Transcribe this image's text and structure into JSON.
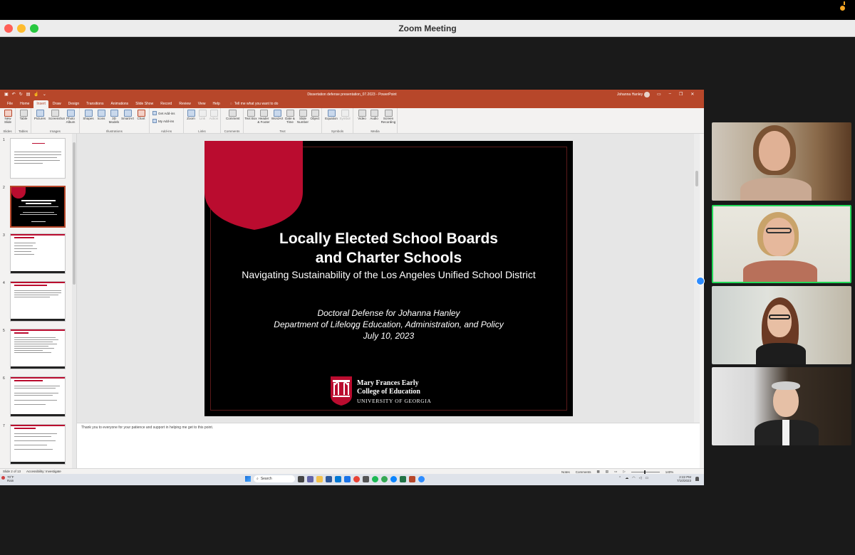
{
  "zoom": {
    "window_title": "Zoom Meeting"
  },
  "ppt": {
    "doc_title": "Dissertation defense presentation_07.2023  -  PowerPoint",
    "user": "Johanna Hanley",
    "tabs": [
      "File",
      "Home",
      "Insert",
      "Draw",
      "Design",
      "Transitions",
      "Animations",
      "Slide Show",
      "Record",
      "Review",
      "View",
      "Help"
    ],
    "active_tab": "Insert",
    "tell_me": "Tell me what you want to do",
    "ribbon": {
      "slides": {
        "new_slide": "New Slide",
        "label": "Slides"
      },
      "tables": {
        "table": "Table",
        "label": "Tables"
      },
      "images": {
        "pictures": "Pictures",
        "screenshot": "Screenshot",
        "photo_album": "Photo Album",
        "label": "Images"
      },
      "illustrations": {
        "shapes": "Shapes",
        "icons": "Icons",
        "models": "3D Models",
        "smartart": "SmartArt",
        "chart": "Chart",
        "label": "Illustrations"
      },
      "addins": {
        "get": "Get Add-ins",
        "my": "My Add-ins",
        "label": "Add-ins"
      },
      "links": {
        "zoom": "Zoom",
        "link": "Link",
        "action": "Action",
        "label": "Links"
      },
      "comments": {
        "comment": "Comment",
        "label": "Comments"
      },
      "text": {
        "textbox": "Text Box",
        "header": "Header & Footer",
        "wordart": "WordArt",
        "datetime": "Date & Time",
        "slidenum": "Slide Number",
        "object": "Object",
        "label": "Text"
      },
      "symbols": {
        "equation": "Equation",
        "symbol": "Symbol",
        "label": "Symbols"
      },
      "media": {
        "video": "Video",
        "audio": "Audio",
        "screen": "Screen Recording",
        "label": "Media"
      }
    },
    "thumb_numbers": [
      "1",
      "2",
      "3",
      "4",
      "5",
      "6",
      "7"
    ],
    "slide": {
      "title_line1": "Locally Elected School Boards",
      "title_line2": "and Charter Schools",
      "subtitle": "Navigating Sustainability of the Los Angeles Unified School District",
      "defense_line": "Doctoral Defense for Johanna Hanley",
      "department": "Department of Lifelong Education, Administration, and Policy",
      "date": "July 10, 2023",
      "logo_line1": "Mary Frances Early",
      "logo_line2": "College of Education",
      "logo_line3": "UNIVERSITY OF GEORGIA"
    },
    "notes": "Thank you to everyone for your patience and support in helping me get to this point.",
    "status": {
      "slide_of": "Slide 2 of 13",
      "accessibility": "Accessibility: Investigate",
      "notes": "Notes",
      "comments": "Comments",
      "zoom": "140%"
    }
  },
  "taskbar": {
    "weather_temp": "70°F",
    "weather_desc": "Rain",
    "search": "Search",
    "time": "2:22 PM",
    "date": "7/10/2023"
  },
  "colors": {
    "ppt_red": "#b7472a",
    "uga_red": "#ba0c2f",
    "speaker_border": "#23d959",
    "zoom_blue": "#2d8cff"
  }
}
